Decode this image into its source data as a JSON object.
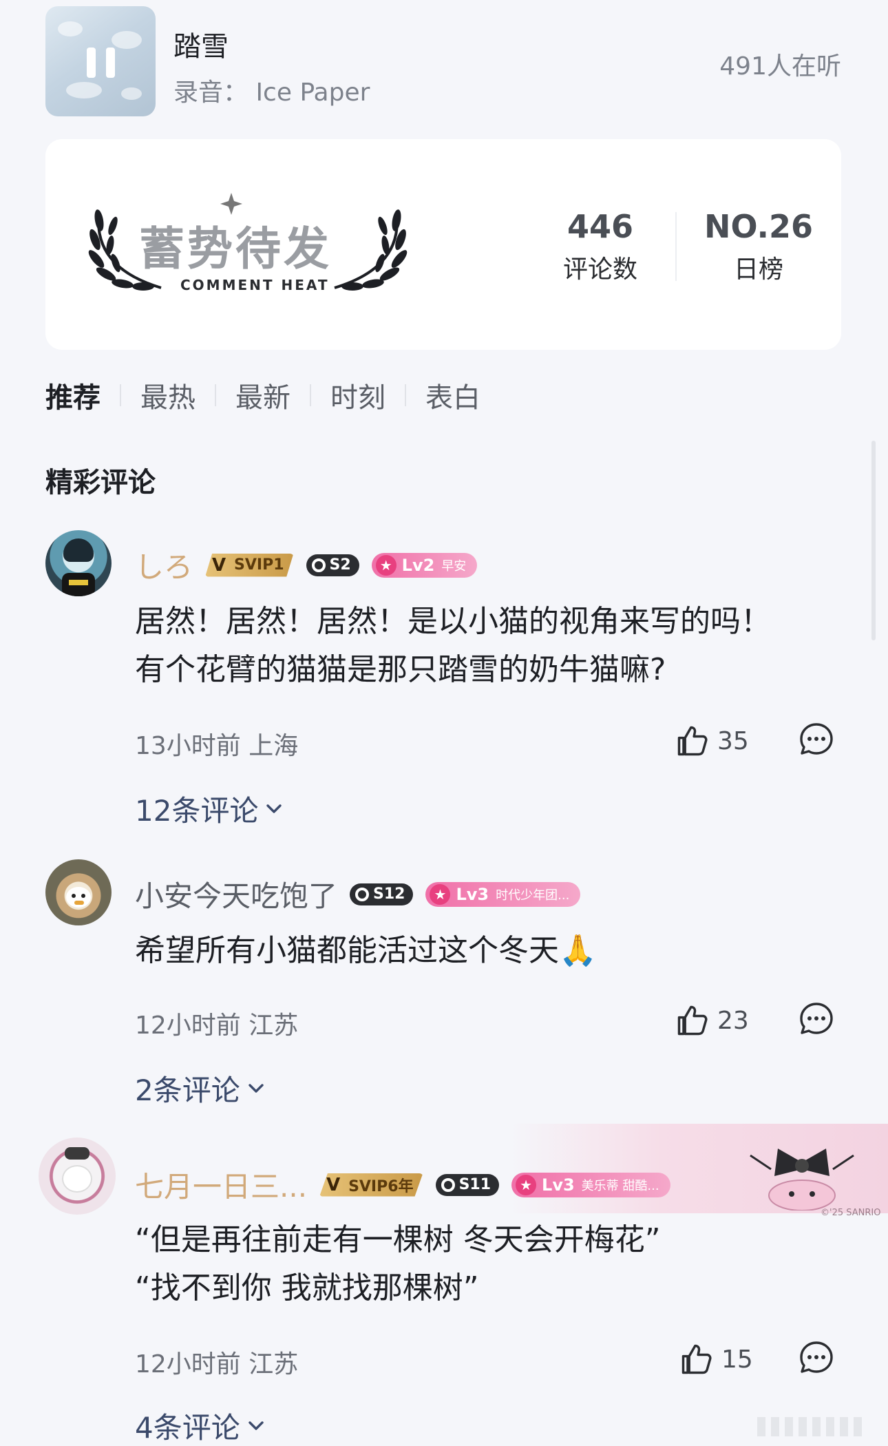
{
  "player": {
    "song_title": "踏雪",
    "recording": "录音：  Ice Paper",
    "listeners": "491人在听"
  },
  "heat": {
    "title": "蓄势待发",
    "subtitle": "COMMENT HEAT",
    "comment_count": "446",
    "comment_count_label": "评论数",
    "rank": "NO.26",
    "rank_label": "日榜"
  },
  "tabs": [
    "推荐",
    "最热",
    "最新",
    "时刻",
    "表白"
  ],
  "section_title": "精彩评论",
  "comments": [
    {
      "user": "しろ",
      "svip": "SVIP1",
      "season": "S2",
      "lv": "Lv2",
      "lv_tag": "早安",
      "lines": [
        "居然！居然！居然！是以小猫的视角来写的吗！",
        "有个花臂的猫猫是那只踏雪的奶牛猫嘛?"
      ],
      "meta": "13小时前 上海",
      "likes": "35",
      "replies": "12条评论"
    },
    {
      "user": "小安今天吃饱了",
      "season": "S12",
      "lv": "Lv3",
      "lv_tag": "时代少年团...",
      "lines": [
        "希望所有小猫都能活过这个冬天🙏"
      ],
      "meta": "12小时前 江苏",
      "likes": "23",
      "replies": "2条评论"
    },
    {
      "user": "七月一日三...",
      "svip": "SVIP6年",
      "season": "S11",
      "lv": "Lv3",
      "lv_tag": "美乐蒂 甜酷...",
      "lines": [
        "“但是再往前走有一棵树 冬天会开梅花”",
        "“找不到你 我就找那棵树”"
      ],
      "meta": "12小时前 江苏",
      "likes": "15",
      "replies": "4条评论",
      "deco_text": "©'25 SANRIO"
    }
  ],
  "colors": {
    "background": "#f5f6fa",
    "gold_name": "#d1a97a",
    "reply_link": "#3b4a6b",
    "lv_badge": "#f070a8"
  },
  "icons": [
    "pause-icon",
    "laurel-icon",
    "thumbs-up-icon",
    "chat-bubble-icon",
    "chevron-down-icon"
  ]
}
